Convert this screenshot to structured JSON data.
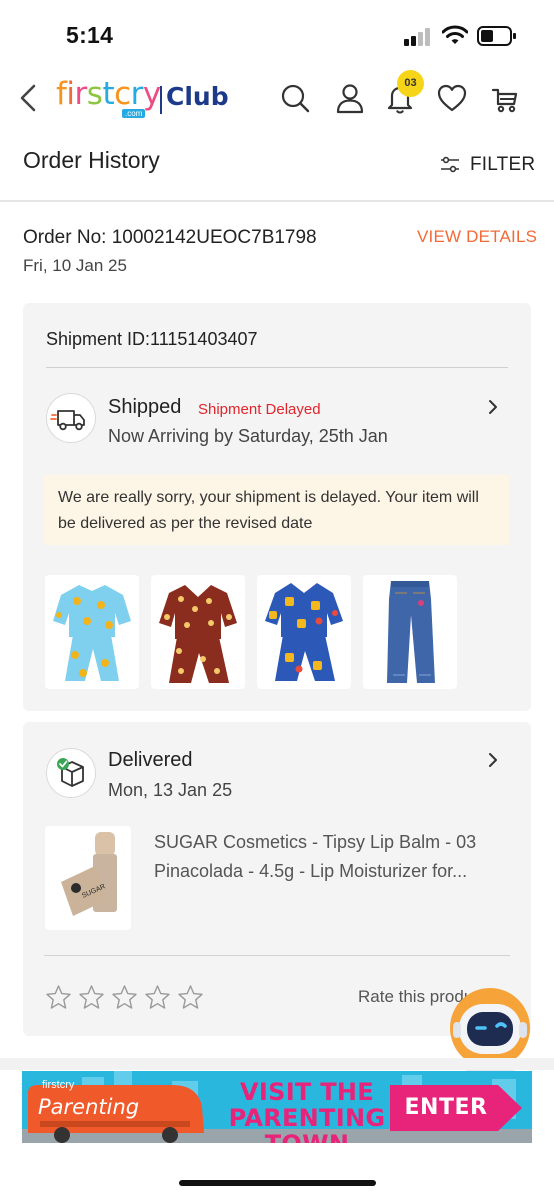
{
  "status_bar": {
    "time": "5:14"
  },
  "header": {
    "logo_first": [
      "f",
      "i",
      "r",
      "s",
      "t",
      "c",
      "r",
      "y"
    ],
    "logo_com": ".com",
    "logo_club": "Club",
    "notification_count": "03"
  },
  "page": {
    "title": "Order History",
    "filter_label": "FILTER"
  },
  "order": {
    "number_label": "Order No: 10002142UEOC7B1798",
    "date": "Fri, 10 Jan 25",
    "view_details": "VIEW DETAILS"
  },
  "shipment": {
    "id_label": "Shipment ID:11151403407",
    "status": "Shipped",
    "badge": "Shipment Delayed",
    "arrival": "Now Arriving by Saturday, 25th Jan",
    "delay_note": "We are really sorry, your shipment is delayed. Your item will be delivered as per the revised date",
    "items": [
      {
        "name": "light-blue-duck-print-pajama-set",
        "color": "#7fd0ee"
      },
      {
        "name": "maroon-polka-print-pajama-set",
        "color": "#8b2d1e"
      },
      {
        "name": "royal-blue-cartoon-print-pajama-set",
        "color": "#2c58b8"
      },
      {
        "name": "blue-denim-jeans",
        "color": "#3f66a8"
      }
    ]
  },
  "delivered": {
    "status": "Delivered",
    "date": "Mon, 13 Jan 25",
    "product_name": "SUGAR Cosmetics - Tipsy Lip Balm - 03 Pinacolada - 4.5g - Lip Moisturizer for...",
    "product_brand_mark": "SUGAR",
    "rate_label": "Rate this product",
    "star_count": 5
  },
  "banner": {
    "brand_small": "firstcry",
    "brand": "Parenting",
    "headline": "VISIT THE PARENTING TOWN",
    "button": "ENTER"
  },
  "colors": {
    "accent_orange": "#f26a37",
    "delay_red": "#e0252b",
    "club_navy": "#1d3a8a",
    "card_bg": "#f4f4f4",
    "note_bg": "#fdf5e6",
    "banner_bg": "#29b7de",
    "banner_pink": "#e8247a"
  }
}
